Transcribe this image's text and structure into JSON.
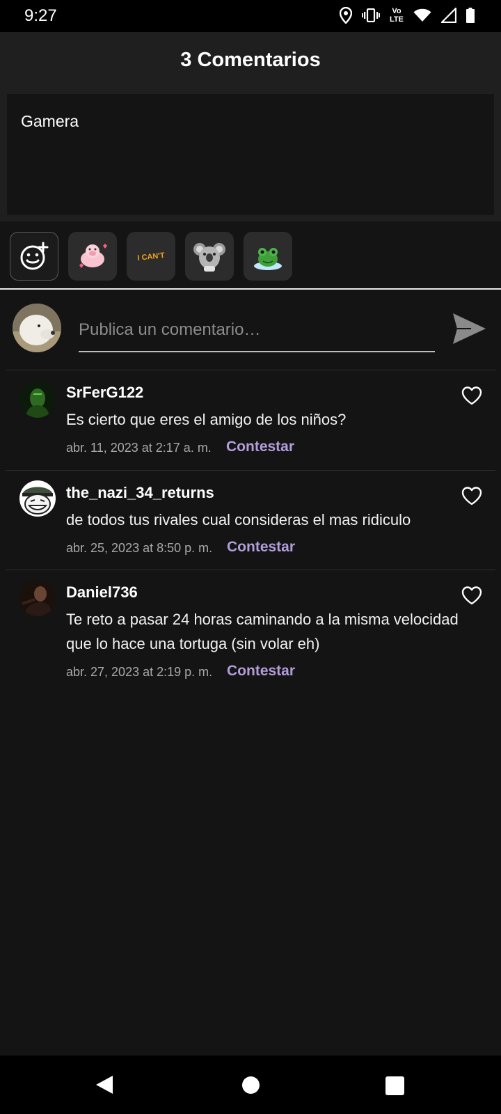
{
  "status_bar": {
    "time": "9:27",
    "volte_top": "Vo",
    "volte_bottom": "LTE",
    "icons": [
      "location-icon",
      "vibrate-icon",
      "volte-icon",
      "wifi-icon",
      "signal-icon",
      "battery-icon"
    ]
  },
  "header": {
    "title": "3 Comentarios"
  },
  "draft": {
    "value": "Gamera"
  },
  "stickers": [
    {
      "icon": "emoji-add-icon"
    },
    {
      "icon": "pig-sticker"
    },
    {
      "icon": "i-cant-sticker",
      "text": "I CAN'T"
    },
    {
      "icon": "koala-sticker"
    },
    {
      "icon": "frog-sticker"
    }
  ],
  "composer": {
    "placeholder": "Publica un comentario…"
  },
  "comments": [
    {
      "author": "SrFerG122",
      "text": "Es cierto que eres el amigo de los niños?",
      "date": "abr. 11, 2023 at 2:17 a. m.",
      "reply": "Contestar"
    },
    {
      "author": "the_nazi_34_returns",
      "text": "de todos tus rivales cual consideras el mas ridiculo",
      "date": "abr. 25, 2023 at 8:50 p. m.",
      "reply": "Contestar"
    },
    {
      "author": "Daniel736",
      "text": "Te reto a pasar 24 horas caminando a la misma velocidad que lo hace una tortuga (sin volar eh)",
      "date": "abr. 27, 2023 at 2:19 p. m.",
      "reply": "Contestar"
    }
  ],
  "colors": {
    "accent": "#b39ddb",
    "background": "#141414",
    "header": "#1f1f1f"
  }
}
